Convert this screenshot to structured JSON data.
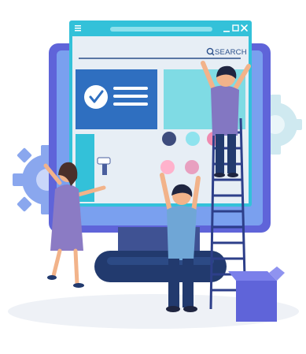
{
  "window": {
    "search_label": "SEARCH",
    "controls": [
      "minimize-icon",
      "maximize-icon",
      "close-icon"
    ],
    "menu_icon": "hamburger-icon"
  },
  "checklist": {
    "icon": "check-circle-icon",
    "rows": 3
  },
  "palette": {
    "background": "#f3f4f7",
    "monitor_bezel": "#5f64d9",
    "window_frame": "#33c1d9",
    "window_content": "#e7eef5",
    "teal_panel": "#7fdbe4",
    "blue_panel": "#2f6fc0",
    "dark_navy": "#1f3566",
    "purple": "#6f5fa8",
    "gear": "#8aa7ee"
  },
  "dots": [
    "#3e4c7d",
    "#8fe3ee",
    "#f08ab0",
    "#ffb2cc",
    "#e8a0c0"
  ],
  "people": [
    {
      "role": "painting-wall",
      "tool": "paint-roller"
    },
    {
      "role": "placing-content",
      "shirt": "#6fa6d6"
    },
    {
      "role": "on-ladder",
      "shirt": "#8377c2"
    }
  ]
}
